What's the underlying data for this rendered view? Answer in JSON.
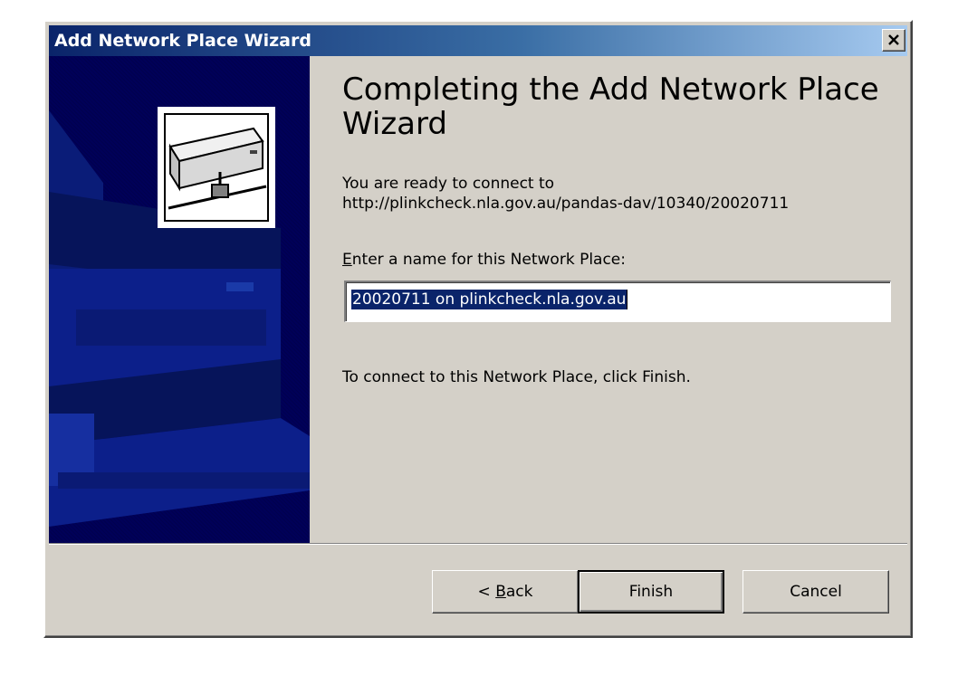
{
  "window": {
    "title": "Add Network Place Wizard",
    "close_symbol": "×"
  },
  "page": {
    "heading": "Completing the Add Network Place Wizard",
    "ready_text": "You are ready to connect to",
    "url": "http://plinkcheck.nla.gov.au/pandas-dav/10340/20020711",
    "name_label_prefix": "E",
    "name_label_rest": "nter a name for this Network Place:",
    "name_value": "20020711 on plinkcheck.nla.gov.au",
    "finish_hint": "To connect to this Network Place, click Finish."
  },
  "buttons": {
    "back_prefix": "< ",
    "back_accel": "B",
    "back_rest": "ack",
    "finish": "Finish",
    "cancel": "Cancel"
  },
  "icons": {
    "sidebar_art": "network-drive-icon",
    "close": "close-icon"
  },
  "colors": {
    "titlebar_start": "#0a246a",
    "titlebar_end": "#a6caf0",
    "dialog_face": "#d4d0c8",
    "sidebar_bg": "#000058",
    "selection": "#0a246a"
  }
}
